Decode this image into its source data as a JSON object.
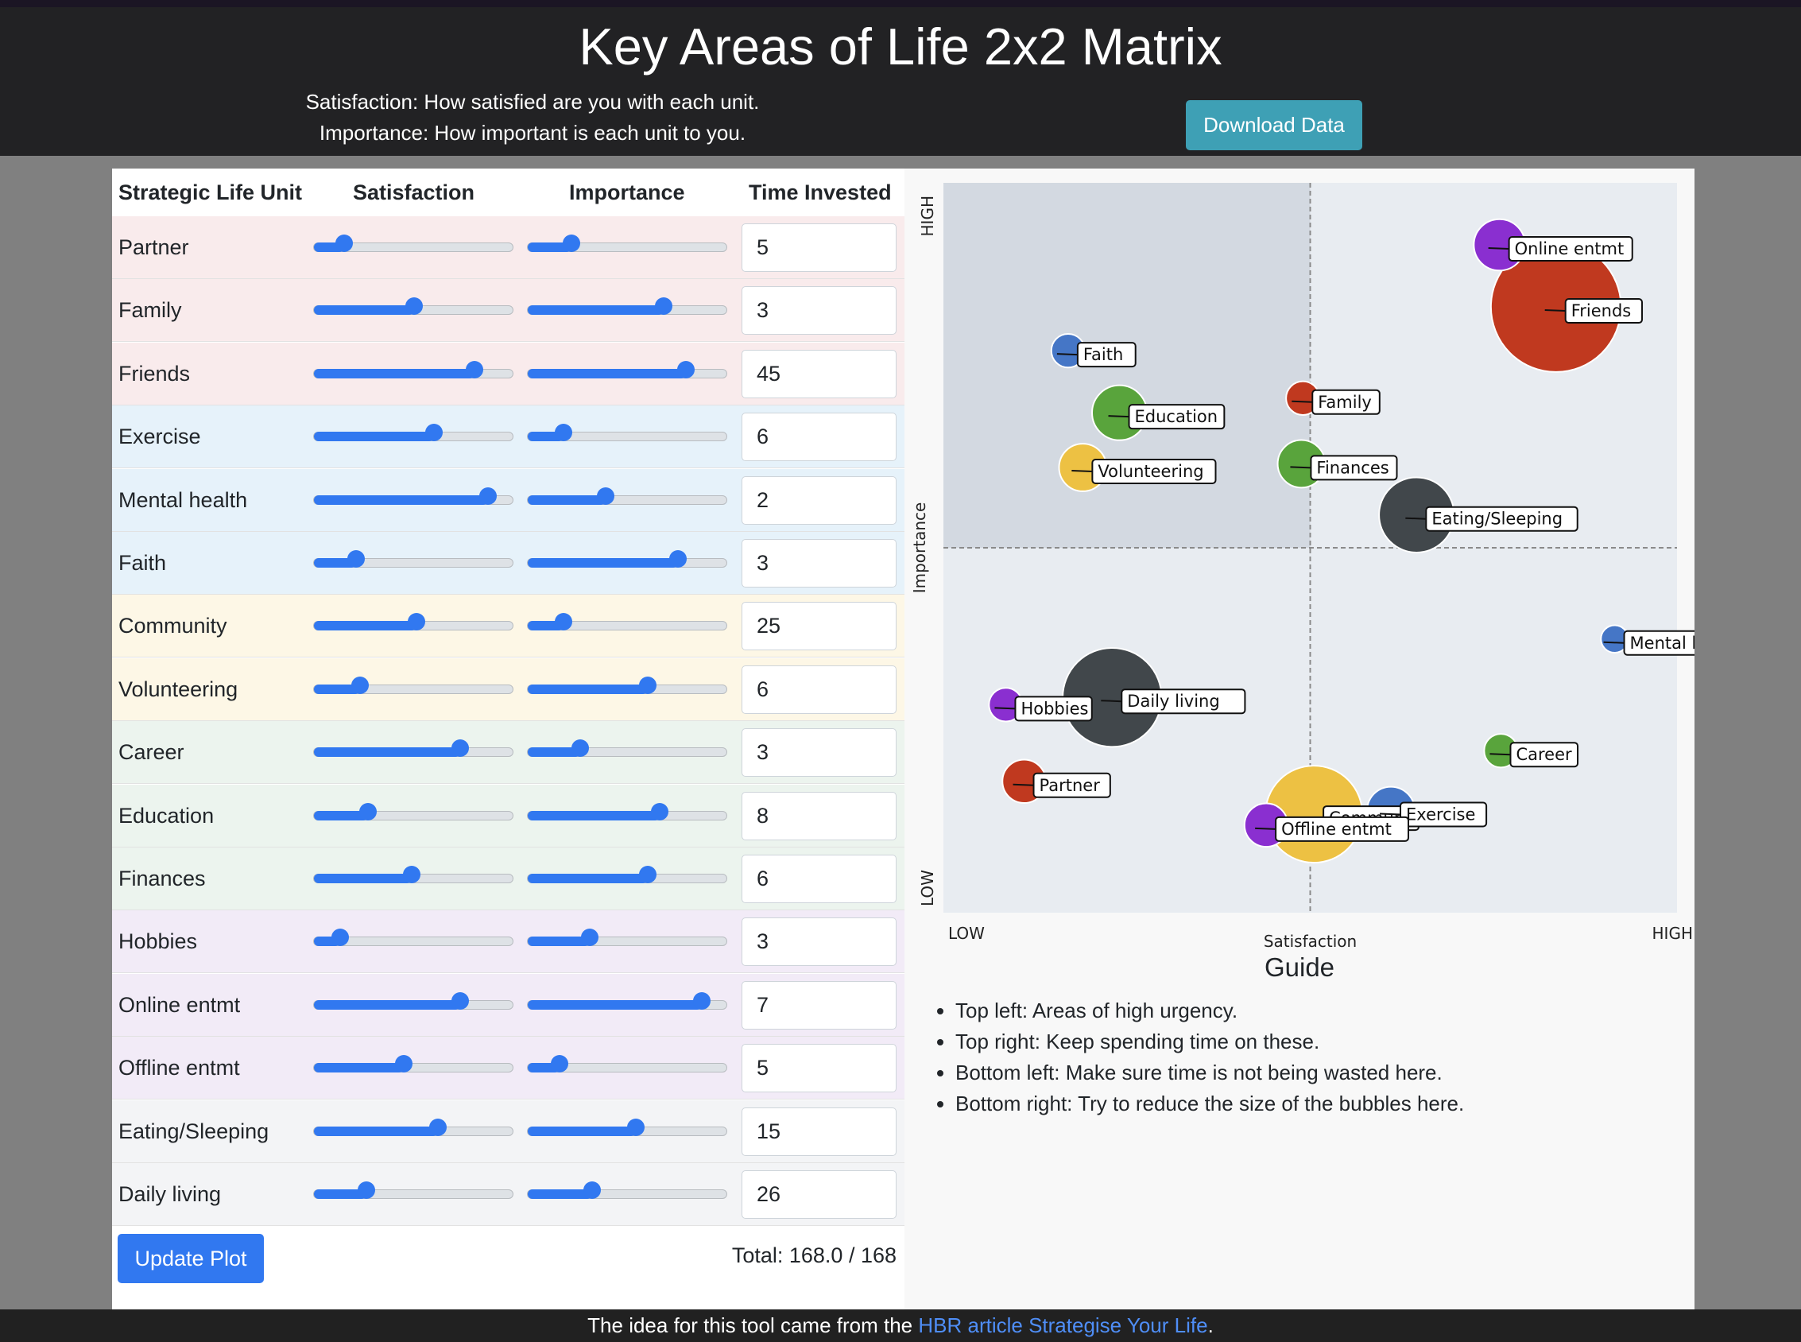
{
  "header": {
    "title": "Key Areas of Life 2x2 Matrix",
    "subtitle_line1": "Satisfaction: How satisfied are you with each unit.",
    "subtitle_line2": "Importance: How important is each unit to you.",
    "download_label": "Download Data"
  },
  "table": {
    "columns": [
      "Strategic Life Unit",
      "Satisfaction",
      "Importance",
      "Time Invested"
    ],
    "rows": [
      {
        "unit": "Partner",
        "satisfaction": 0.15,
        "importance": 0.22,
        "time": "5",
        "bg": "#f9ebec"
      },
      {
        "unit": "Family",
        "satisfaction": 0.5,
        "importance": 0.68,
        "time": "3",
        "bg": "#f9ebec"
      },
      {
        "unit": "Friends",
        "satisfaction": 0.8,
        "importance": 0.79,
        "time": "45",
        "bg": "#f9ebec"
      },
      {
        "unit": "Exercise",
        "satisfaction": 0.6,
        "importance": 0.18,
        "time": "6",
        "bg": "#e6f2fa"
      },
      {
        "unit": "Mental health",
        "satisfaction": 0.87,
        "importance": 0.39,
        "time": "2",
        "bg": "#e6f2fa"
      },
      {
        "unit": "Faith",
        "satisfaction": 0.21,
        "importance": 0.75,
        "time": "3",
        "bg": "#e6f2fa"
      },
      {
        "unit": "Community",
        "satisfaction": 0.51,
        "importance": 0.18,
        "time": "25",
        "bg": "#fdf7e6"
      },
      {
        "unit": "Volunteering",
        "satisfaction": 0.23,
        "importance": 0.6,
        "time": "6",
        "bg": "#fdf7e6"
      },
      {
        "unit": "Career",
        "satisfaction": 0.73,
        "importance": 0.26,
        "time": "3",
        "bg": "#ecf4ee"
      },
      {
        "unit": "Education",
        "satisfaction": 0.27,
        "importance": 0.66,
        "time": "8",
        "bg": "#ecf4ee"
      },
      {
        "unit": "Finances",
        "satisfaction": 0.49,
        "importance": 0.6,
        "time": "6",
        "bg": "#ecf4ee"
      },
      {
        "unit": "Hobbies",
        "satisfaction": 0.13,
        "importance": 0.31,
        "time": "3",
        "bg": "#f2ebf7"
      },
      {
        "unit": "Online entmt",
        "satisfaction": 0.73,
        "importance": 0.87,
        "time": "7",
        "bg": "#f2ebf7"
      },
      {
        "unit": "Offline entmt",
        "satisfaction": 0.45,
        "importance": 0.16,
        "time": "5",
        "bg": "#f2ebf7"
      },
      {
        "unit": "Eating/Sleeping",
        "satisfaction": 0.62,
        "importance": 0.54,
        "time": "15",
        "bg": "#f3f4f6"
      },
      {
        "unit": "Daily living",
        "satisfaction": 0.26,
        "importance": 0.32,
        "time": "26",
        "bg": "#f3f4f6"
      }
    ],
    "update_label": "Update Plot",
    "total_label": "Total: 168.0 / 168"
  },
  "chart_data": {
    "type": "scatter",
    "xlabel": "Satisfaction",
    "ylabel": "Importance",
    "x_low_label": "LOW",
    "x_high_label": "HIGH",
    "y_low_label": "LOW",
    "y_high_label": "HIGH",
    "xlim": [
      0,
      1
    ],
    "ylim": [
      0,
      1
    ],
    "divider_x": 0.5,
    "divider_y": 0.5,
    "quadrant_colors": {
      "top_left": "#d3d9e1",
      "other": "#e8ecf1"
    },
    "size_field": "time invested (hours)",
    "points": [
      {
        "label": "Partner",
        "x": 0.11,
        "y": 0.18,
        "size": 5,
        "color": "#c0391f"
      },
      {
        "label": "Family",
        "x": 0.49,
        "y": 0.705,
        "size": 3,
        "color": "#c0391f"
      },
      {
        "label": "Friends",
        "x": 0.835,
        "y": 0.83,
        "size": 45,
        "color": "#c0391f"
      },
      {
        "label": "Exercise",
        "x": 0.61,
        "y": 0.14,
        "size": 6,
        "color": "#4576c6"
      },
      {
        "label": "Mental health",
        "x": 0.915,
        "y": 0.375,
        "size": 2,
        "color": "#4576c6"
      },
      {
        "label": "Faith",
        "x": 0.17,
        "y": 0.77,
        "size": 3,
        "color": "#4576c6"
      },
      {
        "label": "Community",
        "x": 0.505,
        "y": 0.135,
        "size": 25,
        "color": "#edc143"
      },
      {
        "label": "Volunteering",
        "x": 0.19,
        "y": 0.61,
        "size": 6,
        "color": "#edc143"
      },
      {
        "label": "Career",
        "x": 0.76,
        "y": 0.222,
        "size": 3,
        "color": "#59a43c"
      },
      {
        "label": "Education",
        "x": 0.24,
        "y": 0.685,
        "size": 8,
        "color": "#59a43c"
      },
      {
        "label": "Finances",
        "x": 0.488,
        "y": 0.615,
        "size": 6,
        "color": "#59a43c"
      },
      {
        "label": "Hobbies",
        "x": 0.085,
        "y": 0.285,
        "size": 3,
        "color": "#8a2fd0"
      },
      {
        "label": "Online entmt",
        "x": 0.758,
        "y": 0.915,
        "size": 7,
        "color": "#8a2fd0"
      },
      {
        "label": "Offline entmt",
        "x": 0.44,
        "y": 0.12,
        "size": 5,
        "color": "#8a2fd0"
      },
      {
        "label": "Eating/Sleeping",
        "x": 0.645,
        "y": 0.545,
        "size": 15,
        "color": "#41474b"
      },
      {
        "label": "Daily living",
        "x": 0.23,
        "y": 0.295,
        "size": 26,
        "color": "#41474b"
      }
    ]
  },
  "guide": {
    "title": "Guide",
    "items": [
      "Top left: Areas of high urgency.",
      "Top right: Keep spending time on these.",
      "Bottom left: Make sure time is not being wasted here.",
      "Bottom right: Try to reduce the size of the bubbles here."
    ]
  },
  "footer": {
    "text_before": "The idea for this tool came from the ",
    "link_text": "HBR article Strategise Your Life",
    "text_after": "."
  }
}
